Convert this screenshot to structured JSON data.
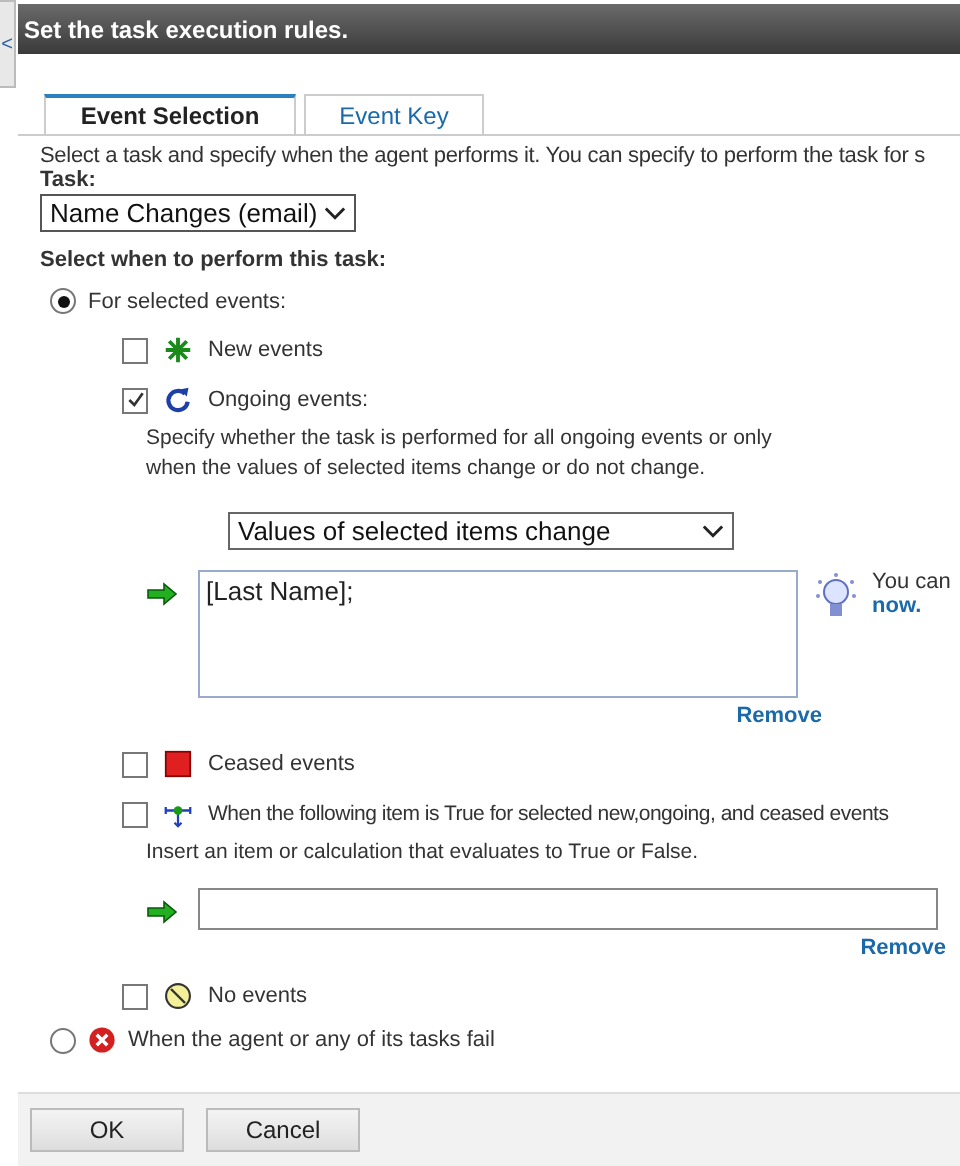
{
  "side_handle": {
    "glyph": "<"
  },
  "header": {
    "title": "Set the task execution rules."
  },
  "tabs": [
    {
      "label": "Event Selection",
      "selected": true
    },
    {
      "label": "Event Key",
      "selected": false
    }
  ],
  "intro": "Select a task and specify when the agent performs it. You can specify to perform the task for s",
  "task": {
    "label": "Task:",
    "value": "Name Changes (email)"
  },
  "when_label": "Select when to perform this task:",
  "options": [
    {
      "kind": "events",
      "label": "For selected events:",
      "selected": true,
      "events": [
        {
          "kind": "new",
          "label": "New events",
          "checked": false
        },
        {
          "kind": "ongoing",
          "label": "Ongoing events:",
          "checked": true,
          "description": "Specify whether the task is performed for all ongoing events or only when the values of selected items change or do not change.",
          "mode": "Values of selected items change",
          "items": "[Last Name];",
          "tip": "You can",
          "tip_link": "now.",
          "remove": "Remove"
        },
        {
          "kind": "ceased",
          "label": "Ceased events",
          "checked": false
        },
        {
          "kind": "condition",
          "label": "When the following item is True for selected new,ongoing, and ceased events",
          "checked": false,
          "hint": "Insert an item or calculation that evaluates to True or False.",
          "remove": "Remove"
        },
        {
          "kind": "none",
          "label": "No events",
          "checked": false
        }
      ]
    },
    {
      "kind": "failure",
      "label": "When the agent or any of its tasks fail",
      "selected": false
    }
  ],
  "buttons": [
    "OK",
    "Cancel"
  ]
}
